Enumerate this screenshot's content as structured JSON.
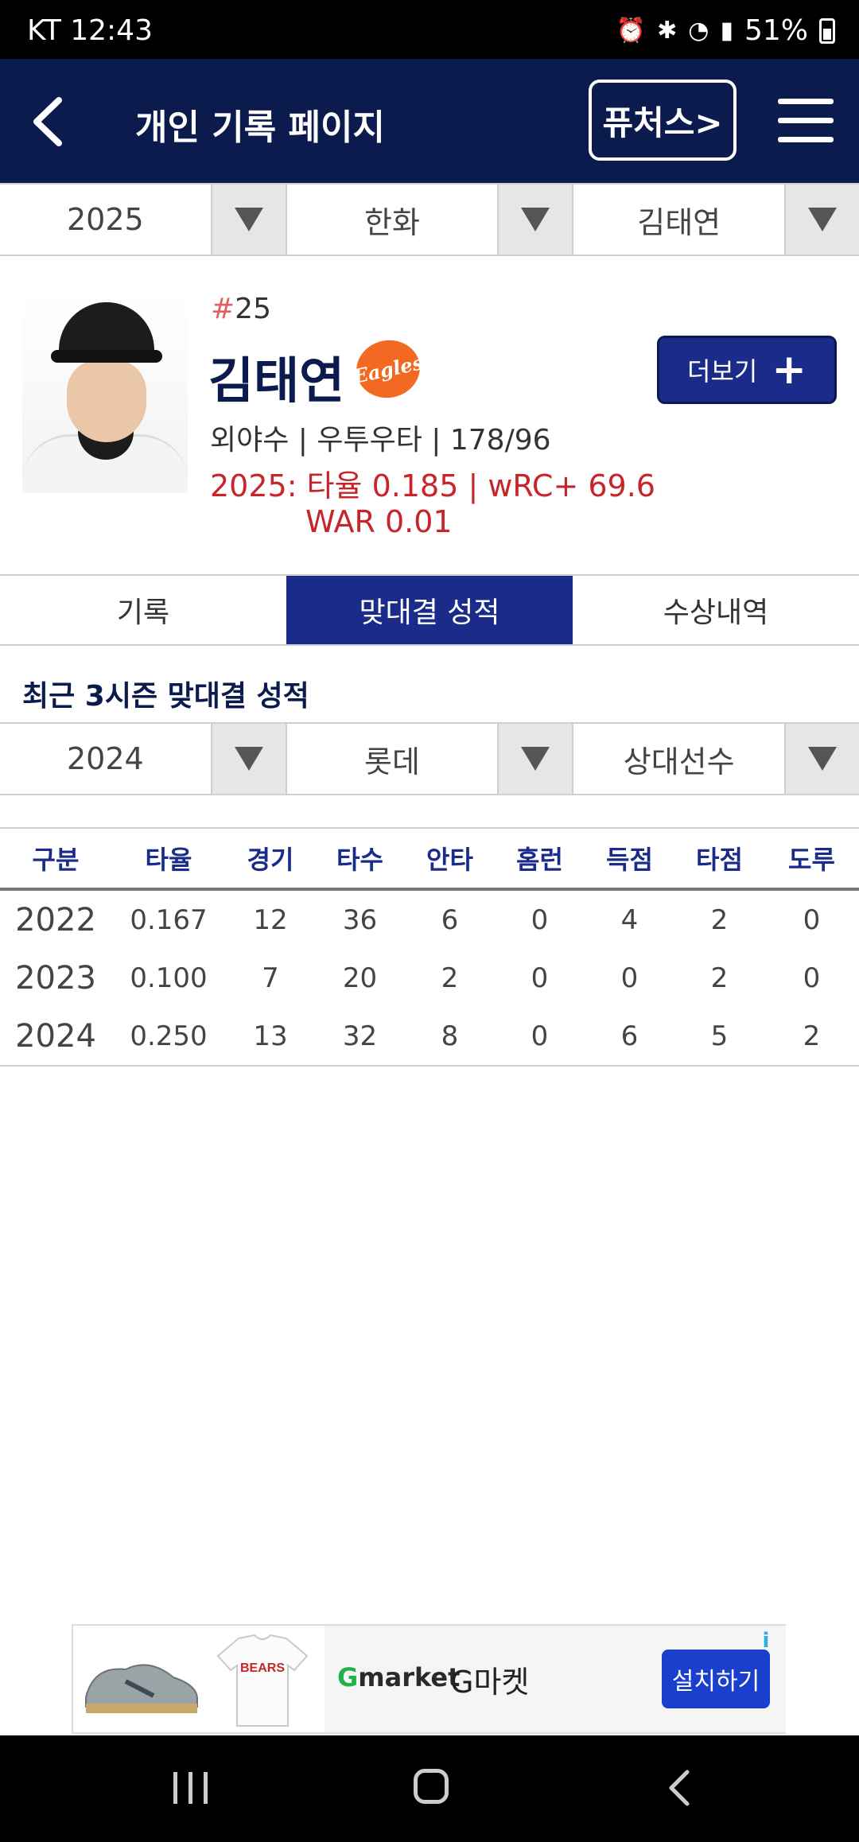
{
  "status_bar": {
    "carrier_time": "KT 12:43",
    "battery": "51%"
  },
  "header": {
    "title": "개인 기록 페이지",
    "futures_button": "퓨처스>"
  },
  "top_filters": {
    "year": "2025",
    "team": "한화",
    "player": "김태연"
  },
  "player": {
    "number_hash": "#",
    "number": "25",
    "name": "김태연",
    "team_logo_text": "Eagles",
    "info": "외야수 | 우투우타 | 178/96",
    "stat_line1": "2025: 타율 0.185 | wRC+ 69.6",
    "stat_line2": "WAR 0.01",
    "more_button": "더보기"
  },
  "tabs": [
    "기록",
    "맞대결 성적",
    "수상내역"
  ],
  "active_tab": "맞대결 성적",
  "section_title": "최근 3시즌 맞대결 성적",
  "matchup_filters": {
    "year": "2024",
    "team": "롯데",
    "opponent": "상대선수"
  },
  "table": {
    "headers": [
      "구분",
      "타율",
      "경기",
      "타수",
      "안타",
      "홈런",
      "득점",
      "타점",
      "도루"
    ],
    "rows": [
      [
        "2022",
        "0.167",
        "12",
        "36",
        "6",
        "0",
        "4",
        "2",
        "0"
      ],
      [
        "2023",
        "0.100",
        "7",
        "20",
        "2",
        "0",
        "0",
        "2",
        "0"
      ],
      [
        "2024",
        "0.250",
        "13",
        "32",
        "8",
        "0",
        "6",
        "5",
        "2"
      ]
    ]
  },
  "ad": {
    "jersey_text": "BEARS",
    "brand_g": "G",
    "brand_rest": "market",
    "app_name": "G마켓",
    "install_button": "설치하기",
    "info_icon": "i"
  },
  "colors": {
    "navy": "#0b1b4d",
    "accent": "#1a2b8a",
    "stat_red": "#c8252b",
    "eagles_orange": "#f26a21"
  }
}
